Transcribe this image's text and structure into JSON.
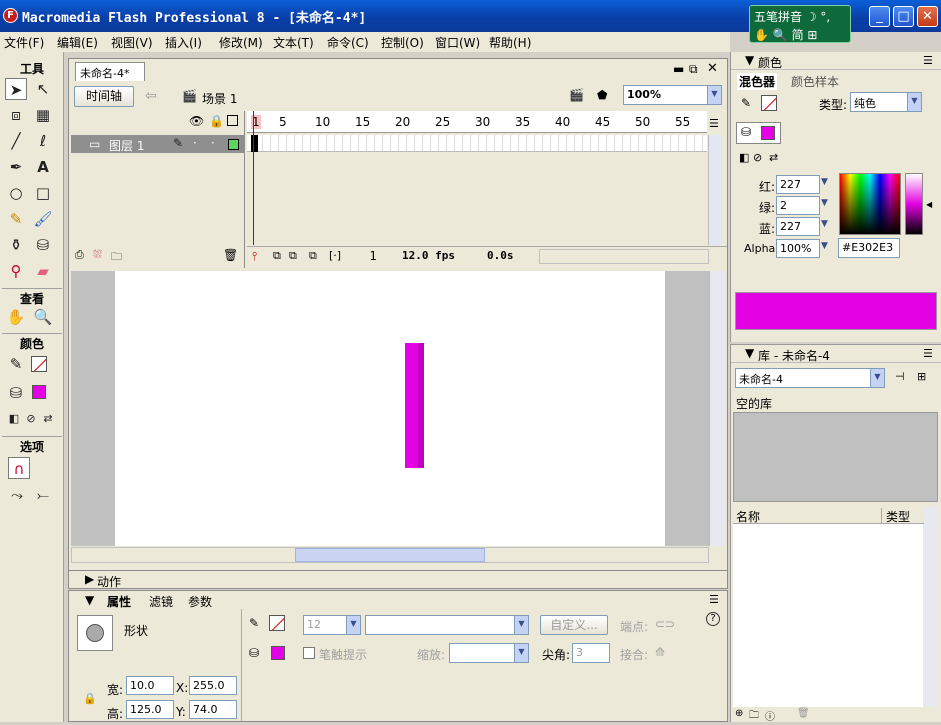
{
  "window": {
    "title": "Macromedia Flash Professional 8 - [未命名-4*]",
    "app_icon": "F"
  },
  "ime": {
    "label": "五笔拼音",
    "moon": "☽ °,",
    "row2": "简 ⊞"
  },
  "menu": [
    "文件(F)",
    "编辑(E)",
    "视图(V)",
    "插入(I)",
    "修改(M)",
    "文本(T)",
    "命令(C)",
    "控制(O)",
    "窗口(W)",
    "帮助(H)"
  ],
  "tools": {
    "heading_tools": "工具",
    "heading_view": "查看",
    "heading_colors": "颜色",
    "heading_options": "选项"
  },
  "document": {
    "tab": "未命名-4*",
    "timeline_button": "时间轴",
    "scene": "场景 1",
    "zoom": "100%",
    "ruler": [
      "1",
      "5",
      "10",
      "15",
      "20",
      "25",
      "30",
      "35",
      "40",
      "45",
      "50",
      "55"
    ],
    "layer_name": "图层 1",
    "current_frame": "1",
    "fps": "12.0 fps",
    "time": "0.0s"
  },
  "color_panel": {
    "title": "颜色",
    "tab_mixer": "混色器",
    "tab_swatches": "颜色样本",
    "type_label": "类型:",
    "type_value": "纯色",
    "red_label": "红:",
    "red": "227",
    "green_label": "绿:",
    "green": "2",
    "blue_label": "蓝:",
    "blue": "227",
    "alpha_label": "Alpha:",
    "alpha": "100%",
    "hex": "#E302E3",
    "fill_color": "#e302e3"
  },
  "library_panel": {
    "title": "库 - 未命名-4",
    "doc": "未命名-4",
    "empty": "空的库",
    "col_name": "名称",
    "col_type": "类型"
  },
  "actions_panel": {
    "title": "动作"
  },
  "properties": {
    "tab_props": "属性",
    "tab_filters": "滤镜",
    "tab_params": "参数",
    "shape_label": "形状",
    "stroke_size": "12",
    "custom_button": "自定义...",
    "cap_label": "端点:",
    "stroke_hint": "笔触提示",
    "scale_label": "缩放:",
    "miter_label": "尖角:",
    "miter_value": "3",
    "join_label": "接合:",
    "w_label": "宽:",
    "w_value": "10.0",
    "h_label": "高:",
    "h_value": "125.0",
    "x_label": "X:",
    "x_value": "255.0",
    "y_label": "Y:",
    "y_value": "74.0",
    "help": "?"
  }
}
